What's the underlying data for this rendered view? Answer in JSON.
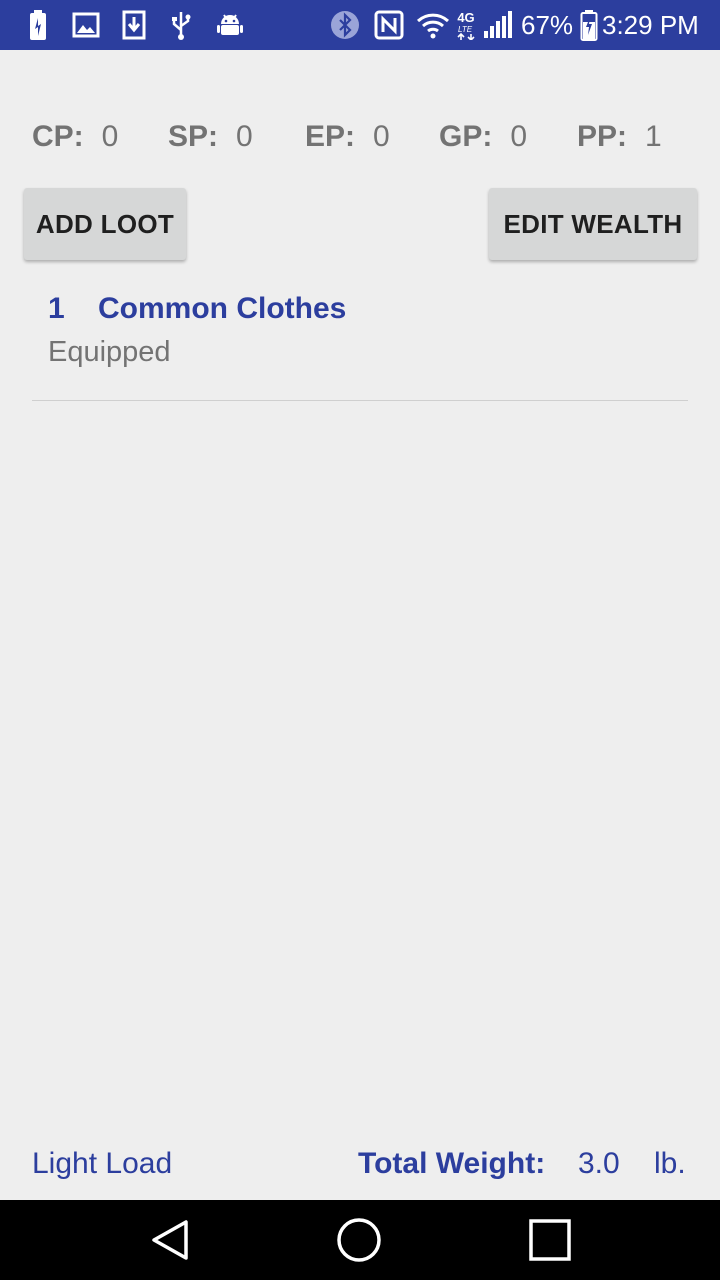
{
  "status_bar": {
    "icons": [
      "battery-saver-icon",
      "image-icon",
      "download-icon",
      "usb-icon",
      "android-icon",
      "bluetooth-icon",
      "nfc-icon",
      "wifi-icon",
      "lte-4g-icon",
      "signal-icon",
      "battery-charging-icon"
    ],
    "network_label": "4G",
    "battery_percent": "67%",
    "time": "3:29 PM"
  },
  "currency": [
    {
      "label": "CP:",
      "value": "0"
    },
    {
      "label": "SP:",
      "value": "0"
    },
    {
      "label": "EP:",
      "value": "0"
    },
    {
      "label": "GP:",
      "value": "0"
    },
    {
      "label": "PP:",
      "value": "1"
    }
  ],
  "actions": {
    "add_loot": "ADD LOOT",
    "edit_wealth": "EDIT WEALTH"
  },
  "items": [
    {
      "quantity": "1",
      "name": "Common Clothes",
      "status": "Equipped"
    }
  ],
  "footer": {
    "load": "Light Load",
    "weight_label": "Total Weight:",
    "weight_value": "3.0",
    "weight_unit": "lb."
  },
  "nav_bar": {
    "icons": [
      "back-icon",
      "home-icon",
      "recents-icon"
    ]
  },
  "colors": {
    "accent": "#2c3e9e",
    "background": "#eeeeee",
    "text_secondary": "#737373"
  }
}
